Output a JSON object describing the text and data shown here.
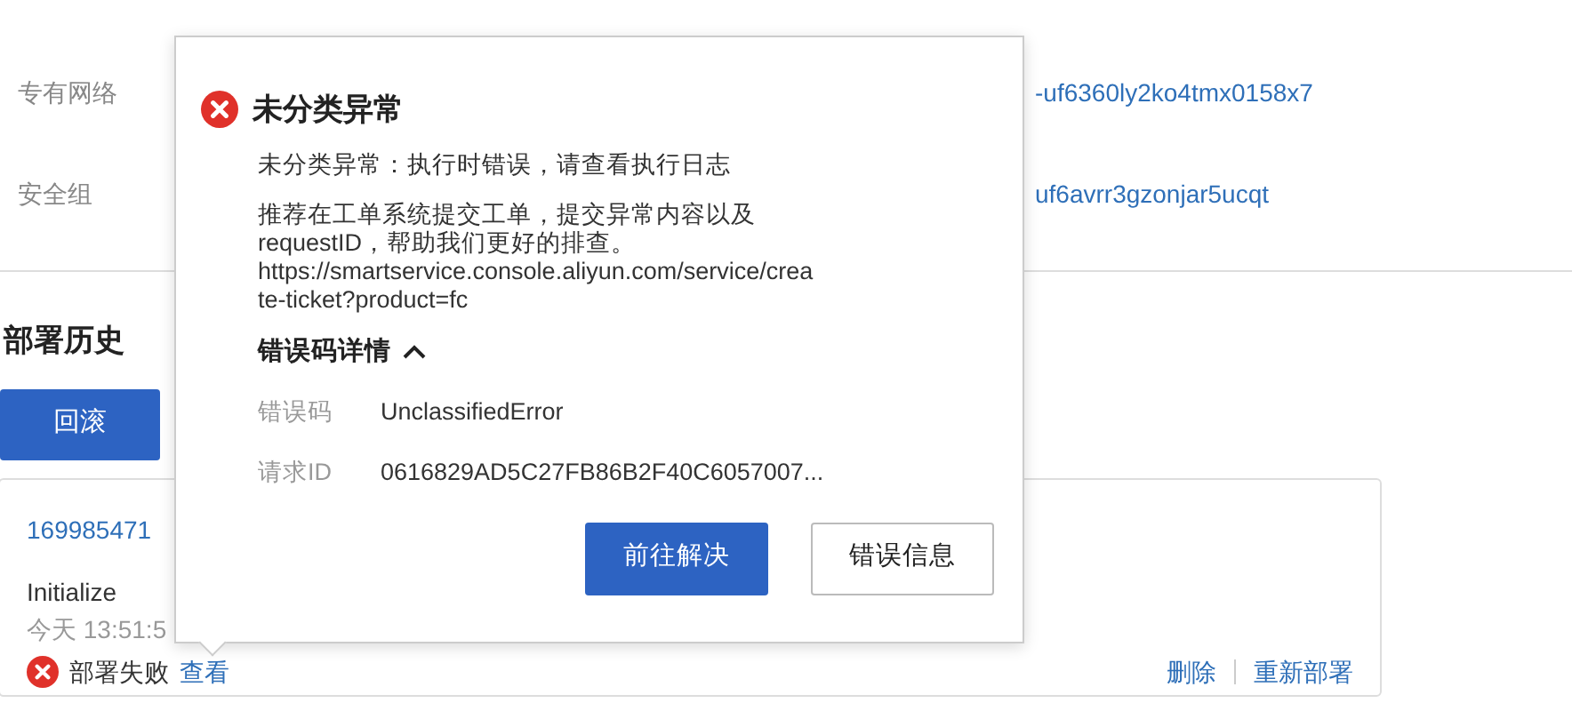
{
  "background": {
    "fields": [
      {
        "label": "专有网络",
        "value": "-uf6360ly2ko4tmx0158x7"
      },
      {
        "label": "安全组",
        "value": "uf6avrr3gzonjar5ucqt"
      }
    ],
    "section_title": "部署历史",
    "rollback_button": "回滚",
    "deployment": {
      "id": "169985471",
      "name": "Initialize",
      "time": "今天 13:51:5",
      "status": "部署失败",
      "view_link": "查看",
      "actions": [
        "删除",
        "重新部署"
      ]
    }
  },
  "popover": {
    "title": "未分类异常",
    "message": "未分类异常：执行时错误，请查看执行日志",
    "advice_lines": [
      "推荐在工单系统提交工单，提交异常内容以及",
      "requestID，帮助我们更好的排查。",
      "https://smartservice.console.aliyun.com/service/crea",
      "te-ticket?product=fc"
    ],
    "details_toggle": "错误码详情",
    "expanded": true,
    "details": [
      {
        "label": "错误码",
        "value": "UnclassifiedError"
      },
      {
        "label": "请求ID",
        "value": "0616829AD5C27FB86B2F40C6057007..."
      }
    ],
    "buttons": [
      {
        "label": "前往解决",
        "kind": "primary"
      },
      {
        "label": "错误信息",
        "kind": "secondary"
      }
    ]
  }
}
